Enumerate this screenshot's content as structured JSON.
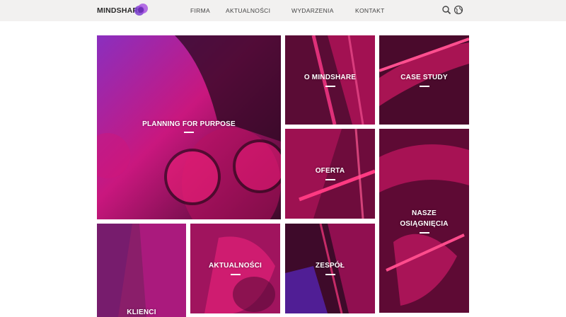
{
  "header": {
    "logo_text": "MINDSHARE",
    "nav": [
      "FIRMA",
      "AKTUALNOŚCI",
      "WYDARZENIA",
      "KONTAKT"
    ],
    "icons": [
      "search-icon",
      "globe-icon"
    ]
  },
  "tiles": {
    "planning": "PLANNING FOR PURPOSE",
    "o_mindshare": "O MINDSHARE",
    "case_study": "CASE STUDY",
    "oferta": "OFERTA",
    "nasze_line1": "NASZE",
    "nasze_line2": "OSIĄGNIĘCIA",
    "klienci": "KLIENCI",
    "aktualnosci": "AKTUALNOŚCI",
    "zespol": "ZESPÓŁ"
  },
  "colors": {
    "header_bg": "#f2f1f0",
    "accent_magenta": "#e0127a",
    "accent_purple": "#8a2fbf"
  }
}
